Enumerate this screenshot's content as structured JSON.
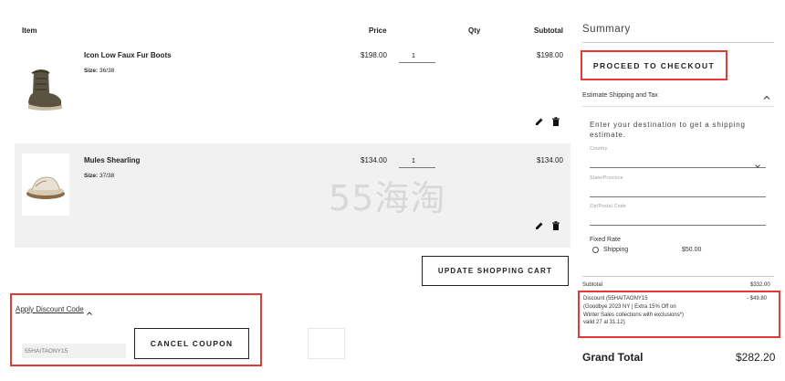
{
  "cart": {
    "headers": {
      "item": "Item",
      "price": "Price",
      "qty": "Qty",
      "subtotal": "Subtotal"
    },
    "items": [
      {
        "name": "Icon Low Faux Fur Boots",
        "size_label": "Size:",
        "size_value": "36/38",
        "price": "$198.00",
        "qty": "1",
        "subtotal": "$198.00"
      },
      {
        "name": "Mules Shearling",
        "size_label": "Size:",
        "size_value": "37/38",
        "price": "$134.00",
        "qty": "1",
        "subtotal": "$134.00"
      }
    ],
    "update_label": "UPDATE SHOPPING CART",
    "watermark": "55海淘"
  },
  "discount": {
    "toggle_label": "Apply Discount Code",
    "code_value": "55HAITAONY15",
    "cancel_label": "CANCEL COUPON"
  },
  "summary": {
    "title": "Summary",
    "checkout_label": "PROCEED TO CHECKOUT",
    "shipping_toggle": "Estimate Shipping and Tax",
    "shipping_hint": "Enter your destination to get a shipping estimate.",
    "country_label": "Country",
    "state_label": "State/Province",
    "zip_label": "Zip/Postal Code",
    "fixed_rate_label": "Fixed Rate",
    "shipping_option_label": "Shipping",
    "shipping_option_price": "$50.00",
    "subtotal_label": "Subtotal",
    "subtotal_value": "$332.00",
    "discount_label": "Discount (55HAITAONY15",
    "discount_desc": "(Goodbye 2023 NY | Extra 15% Off on Winter Sales collections with exclusions*) valid 27 al 31.12)",
    "discount_value": "- $49.80",
    "grand_total_label": "Grand Total",
    "grand_total_value": "$282.20"
  },
  "colors": {
    "highlight": "#e53935",
    "row_bg": "#f1f1f1"
  }
}
